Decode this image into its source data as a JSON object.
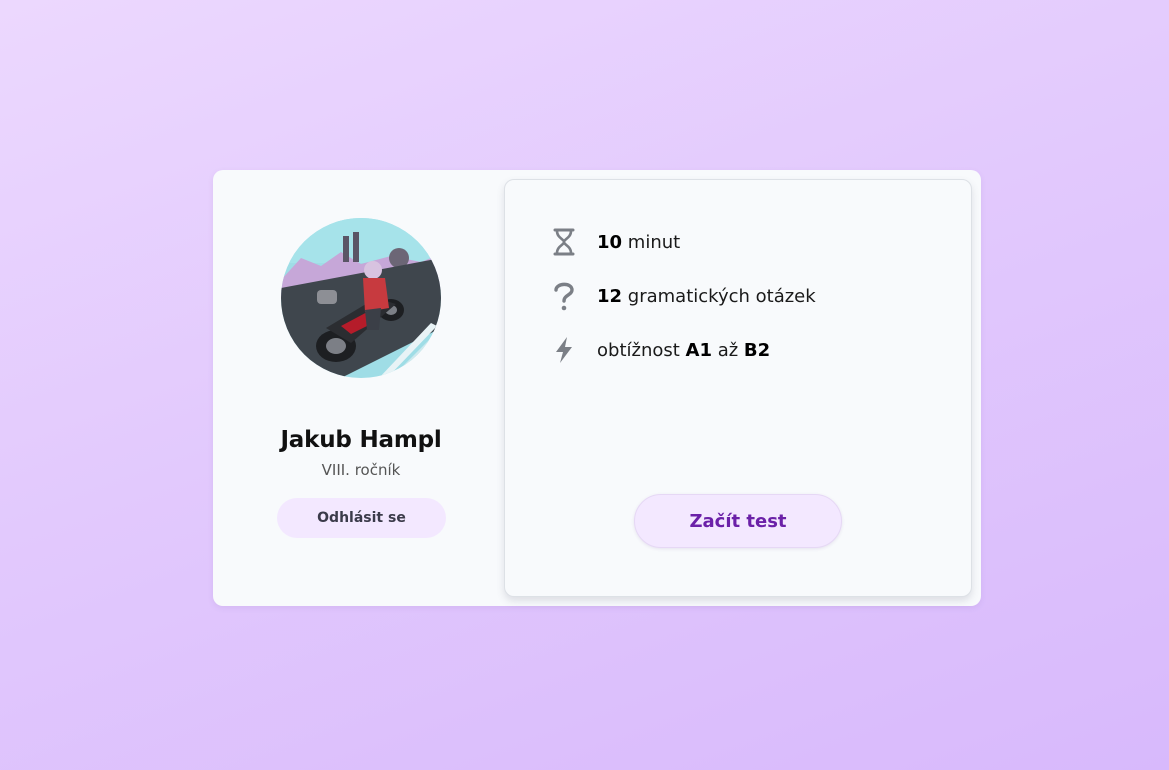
{
  "profile": {
    "name": "Jakub Hampl",
    "grade": "VIII. ročník",
    "logout_label": "Odhlásit se"
  },
  "test_info": {
    "time": {
      "value": "10",
      "text": " minut",
      "icon": "hourglass-icon"
    },
    "questions": {
      "value": "12",
      "text": " gramatických otázek",
      "icon": "question-mark-icon"
    },
    "difficulty": {
      "prefix": "obtížnost ",
      "from": "A1",
      "middle": " až ",
      "to": "B2",
      "icon": "lightning-bolt-icon"
    },
    "start_label": "Začít test"
  },
  "colors": {
    "accent": "#6b21a8",
    "button_bg": "#f3e8ff",
    "icon": "#7b7f86"
  }
}
